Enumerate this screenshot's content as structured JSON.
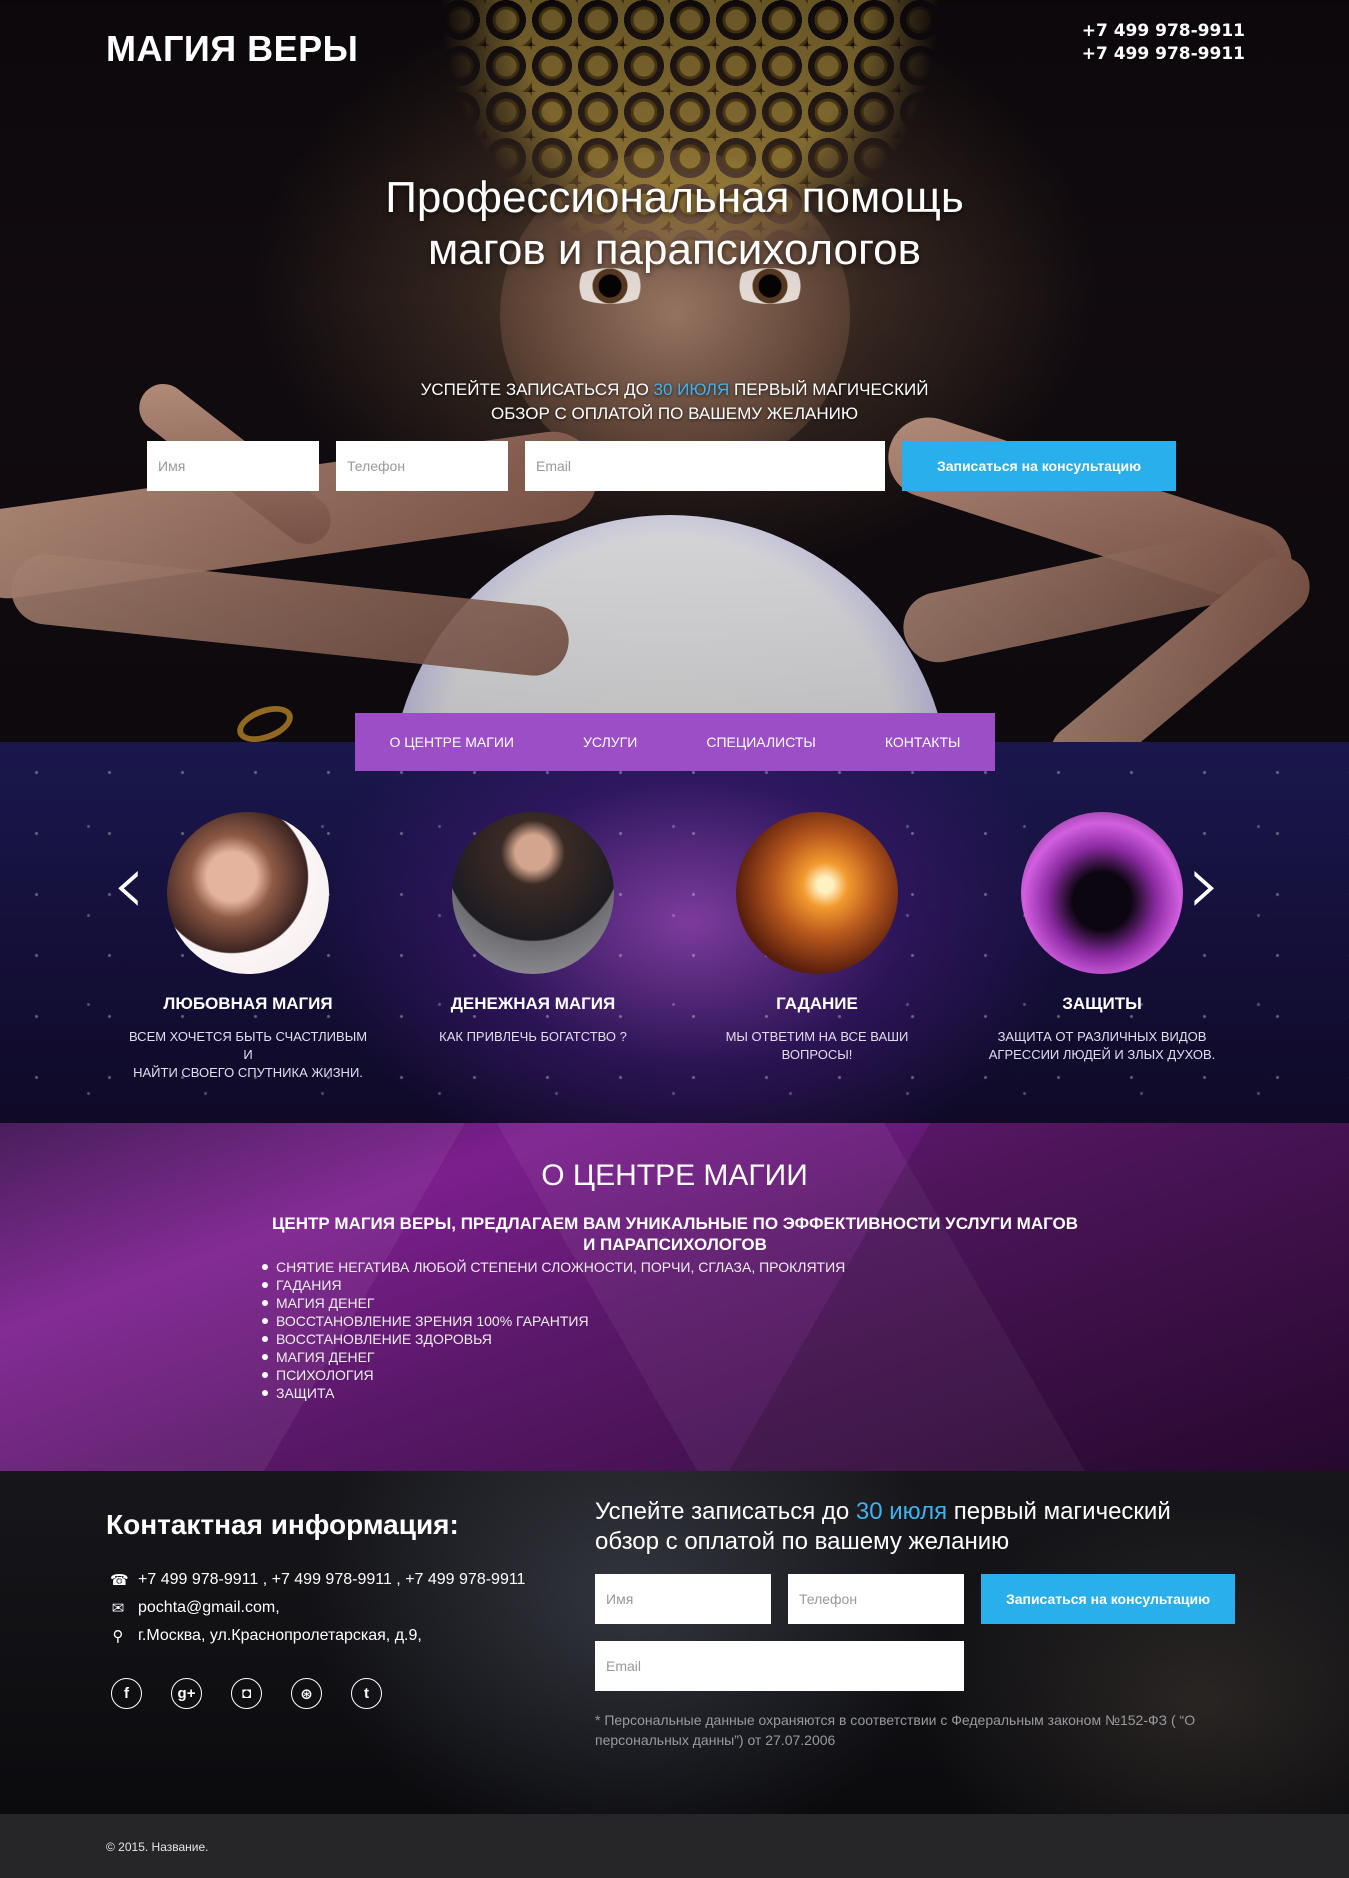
{
  "header": {
    "logo": "МАГИЯ ВЕРЫ",
    "phone_1": "+7 499 978-9911",
    "phone_2": "+7 499 978-9911"
  },
  "hero": {
    "title_line1": "Профессиональная помощь",
    "title_line2": "магов и парапсихологов",
    "offer_before": "Успейте записаться до ",
    "offer_accent": "30 июля",
    "offer_after": " первый магический",
    "offer_line2": "обзор с оплатой по вашему желанию",
    "form": {
      "name_placeholder": "Имя",
      "phone_placeholder": "Телефон",
      "email_placeholder": "Email",
      "submit_label": "Записаться на консультацию"
    }
  },
  "nav": {
    "items": [
      "О ЦЕНТРЕ МАГИИ",
      "УСЛУГИ",
      "СПЕЦИАЛИСТЫ",
      "КОНТАКТЫ"
    ]
  },
  "services": {
    "prev_arrow": "‹",
    "next_arrow": "›",
    "cards": [
      {
        "title": "ЛЮБОВНАЯ МАГИЯ",
        "text_line1": "ВСЕМ ХОЧЕТСЯ БЫТЬ СЧАСТЛИВЫМ И",
        "text_line2": "НАЙТИ СВОЕГО СПУТНИКА ЖИЗНИ."
      },
      {
        "title": "ДЕНЕЖНАЯ МАГИЯ",
        "text_line1": "КАК ПРИВЛЕЧЬ БОГАТСТВО ?",
        "text_line2": ""
      },
      {
        "title": "ГАДАНИЕ",
        "text_line1": "МЫ ОТВЕТИМ НА ВСЕ ВАШИ ВОПРОСЫ!",
        "text_line2": ""
      },
      {
        "title": "ЗАЩИТЫ",
        "text_line1": "ЗАЩИТА ОТ РАЗЛИЧНЫХ ВИДОВ",
        "text_line2": "АГРЕССИИ ЛЮДЕЙ И ЗЛЫХ ДУХОВ."
      }
    ]
  },
  "about": {
    "title": "О ЦЕНТРЕ МАГИИ",
    "lead_line1": "ЦЕНТР МАГИЯ ВЕРЫ, ПРЕДЛАГАЕМ ВАМ УНИКАЛЬНЫЕ ПО ЭФФЕКТИВНОСТИ УСЛУГИ МАГОВ",
    "lead_line2": "И ПАРАПСИХОЛОГОВ",
    "list": [
      "СНЯТИЕ НЕГАТИВА ЛЮБОЙ СТЕПЕНИ СЛОЖНОСТИ, ПОРЧИ, СГЛАЗА, ПРОКЛЯТИЯ",
      "ГАДАНИЯ",
      "МАГИЯ ДЕНЕГ",
      "ВОССТАНОВЛЕНИЕ ЗРЕНИЯ 100% ГАРАНТИЯ",
      "ВОССТАНОВЛЕНИЕ ЗДОРОВЬЯ",
      "МАГИЯ ДЕНЕГ",
      "ПСИХОЛОГИЯ",
      "ЗАЩИТА"
    ]
  },
  "contact": {
    "title": "Контактная информация:",
    "phones": "+7 499 978-9911 , +7 499 978-9911 , +7 499 978-9911",
    "email": "pochta@gmail.com,",
    "address": "г.Москва, ул.Краснопролетарская, д.9,",
    "icons": [
      "phone-icon",
      "mail-icon",
      "map-pin-icon"
    ],
    "social": [
      "facebook-icon",
      "google-plus-icon",
      "instagram-icon",
      "dribbble-icon",
      "twitter-icon"
    ],
    "offer_before": "Успейте записаться до ",
    "offer_accent": "30 июля",
    "offer_after": " первый магический обзор с оплатой по вашему желанию",
    "form": {
      "name_placeholder": "Имя",
      "phone_placeholder": "Телефон",
      "email_placeholder": "Email",
      "submit_label": "Записаться на консультацию"
    },
    "note": "* Персональные данные охраняются в соответствии с Федеральным законом №152-ФЗ ( “О персональных данны”) от 27.07.2006"
  },
  "footer": {
    "copyright": "© 2015. Название."
  },
  "colors": {
    "accent": "#3fb2f0",
    "button": "#29b0ec",
    "nav": "#9b4ec6"
  }
}
